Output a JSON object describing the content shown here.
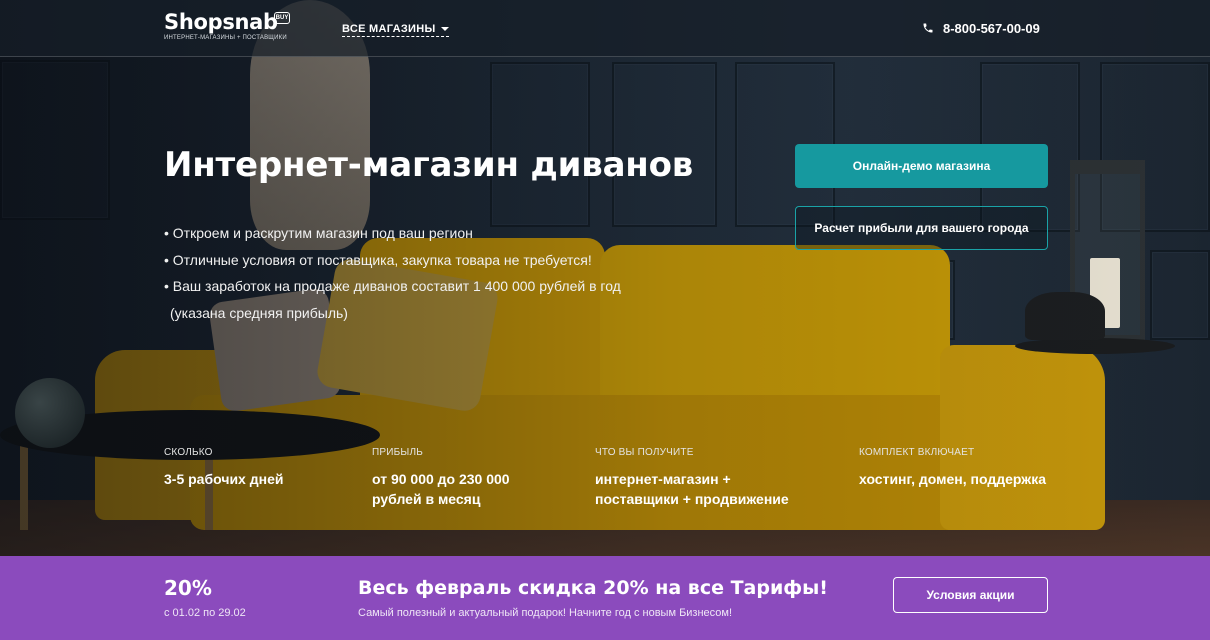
{
  "header": {
    "logo_name": "Shopsnab",
    "logo_badge": "BUY",
    "logo_tagline": "ИНТЕРНЕТ-МАГАЗИНЫ + ПОСТАВЩИКИ",
    "stores_menu": "ВСЕ МАГАЗИНЫ",
    "phone": "8-800-567-00-09"
  },
  "hero": {
    "title": "Интернет-магазин диванов",
    "bullets": [
      "• Откроем  и раскрутим  магазин под ваш регион",
      "• Отличные условия от поставщика, закупка товара не требуется!",
      "• Ваш заработок на продаже диванов составит 1 400 000 рублей в год",
      "(указана средняя прибыль)"
    ],
    "btn_demo": "Онлайн-демо магазина",
    "btn_calc": "Расчет прибыли для вашего города"
  },
  "stats": [
    {
      "label": "СКОЛЬКО",
      "value": "3-5 рабочих дней"
    },
    {
      "label": "ПРИБЫЛЬ",
      "value": "от 90 000 до 230 000 рублей в месяц"
    },
    {
      "label": "ЧТО ВЫ ПОЛУЧИТЕ",
      "value": "интернет-магазин + поставщики + продвижение"
    },
    {
      "label": "КОМПЛЕКТ ВКЛЮЧАЕТ",
      "value": "хостинг, домен, поддержка"
    }
  ],
  "promo": {
    "percent": "20%",
    "dates": "с 01.02 по 29.02",
    "title": "Весь февраль скидка 20% на все Тарифы!",
    "subtitle": "Самый полезный и актуальный подарок! Начните год с новым Бизнесом!",
    "button": "Условия акции"
  },
  "colors": {
    "accent_teal": "#16999f",
    "promo_purple": "#8b4bbd",
    "sofa_yellow": "#c79a06"
  }
}
